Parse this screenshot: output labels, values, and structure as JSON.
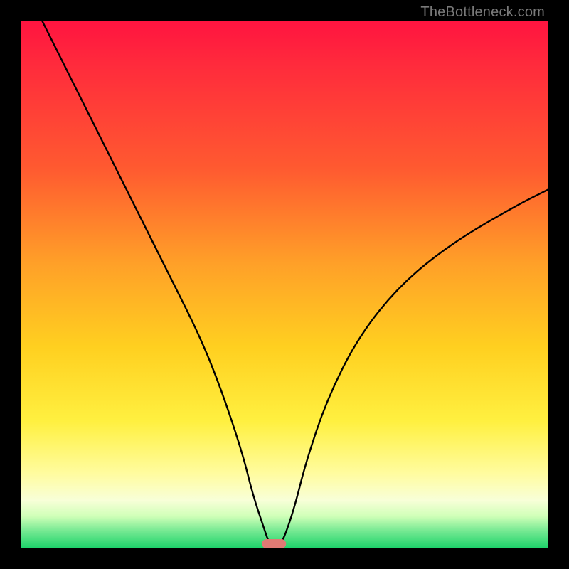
{
  "attribution": "TheBottleneck.com",
  "chart_data": {
    "type": "line",
    "title": "",
    "xlabel": "",
    "ylabel": "",
    "xlim": [
      0,
      100
    ],
    "ylim": [
      0,
      100
    ],
    "grid": false,
    "legend": false,
    "series": [
      {
        "name": "bottleneck-curve",
        "x": [
          4,
          10,
          16,
          22,
          28,
          34,
          38,
          42,
          44,
          46,
          47,
          48,
          49,
          50,
          52,
          54,
          58,
          64,
          72,
          82,
          94,
          100
        ],
        "y": [
          100,
          88,
          76,
          64,
          52,
          40,
          30,
          18,
          10,
          4,
          1,
          0,
          0.5,
          2,
          8,
          16,
          28,
          40,
          50,
          58,
          65,
          68
        ]
      }
    ],
    "marker": {
      "x": 48,
      "y": 0,
      "color": "#e07a74",
      "shape": "pill"
    },
    "background_gradient_stops": [
      {
        "pos": 0,
        "color": "#ff1440"
      },
      {
        "pos": 28,
        "color": "#ff5a30"
      },
      {
        "pos": 62,
        "color": "#ffd020"
      },
      {
        "pos": 86,
        "color": "#fffca0"
      },
      {
        "pos": 100,
        "color": "#1fd36b"
      }
    ]
  }
}
